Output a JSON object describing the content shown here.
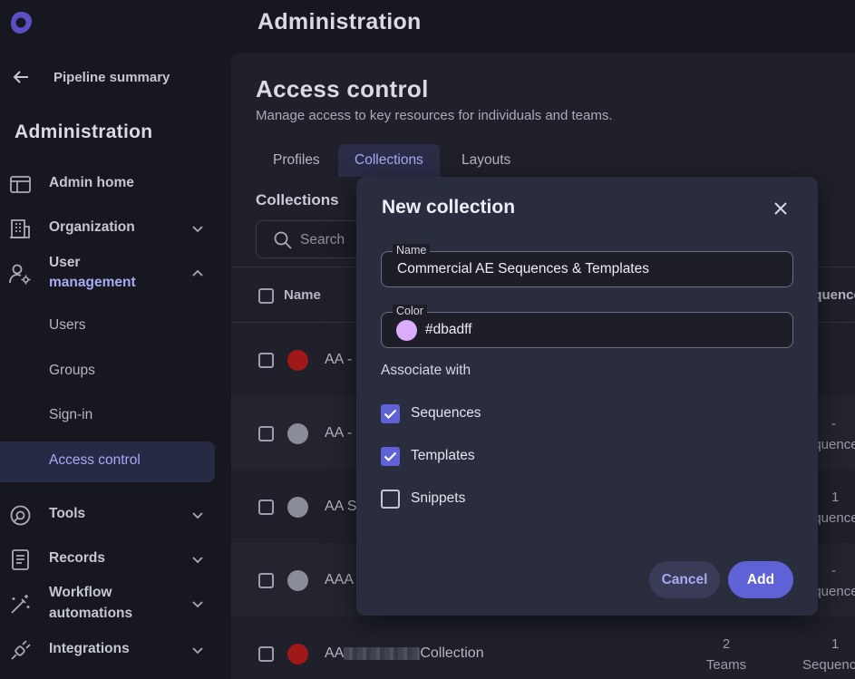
{
  "header": {
    "title": "Administration"
  },
  "sidebar": {
    "back_label": "Pipeline summary",
    "section_title": "Administration",
    "items": [
      {
        "label": "Admin home",
        "icon": "layout-icon"
      },
      {
        "label": "Organization",
        "icon": "building-icon"
      },
      {
        "label_line1": "User",
        "label_line2": "management",
        "icon": "user-gear-icon"
      },
      {
        "label": "Tools",
        "icon": "tools-icon"
      },
      {
        "label": "Records",
        "icon": "records-icon"
      },
      {
        "label_line1": "Workflow",
        "label_line2": "automations",
        "icon": "wand-icon"
      },
      {
        "label": "Integrations",
        "icon": "plug-icon"
      }
    ],
    "sub_items": [
      "Users",
      "Groups",
      "Sign-in",
      "Access control"
    ]
  },
  "main": {
    "title": "Access control",
    "subtitle": "Manage access to key resources for individuals and teams.",
    "tabs": [
      "Profiles",
      "Collections",
      "Layouts"
    ],
    "active_tab": "Collections",
    "collections_title": "Collections",
    "search_placeholder": "Search",
    "table": {
      "col_name": "Name",
      "col_sequences": "equence",
      "rows": [
        {
          "name": "AA - I",
          "color": "#a01818",
          "c1": "",
          "c1b": "",
          "c2": "",
          "c2b": ""
        },
        {
          "name": "AA - I",
          "color": "#8a8c99",
          "c1": "",
          "c1b": "",
          "c2": "-",
          "c2b": "equence"
        },
        {
          "name": "AA Sa",
          "color": "#8a8c99",
          "c1": "",
          "c1b": "",
          "c2": "1",
          "c2b": "equence"
        },
        {
          "name": "AAA -",
          "color": "#8a8c99",
          "c1": "",
          "c1b": "",
          "c2": "-",
          "c2b": "equence"
        },
        {
          "name_prefix": "AA",
          "name_suffix": "Collection",
          "color": "#a01818",
          "c1": "2",
          "c1b": "Teams",
          "c2": "1",
          "c2b": "Sequenc"
        }
      ]
    }
  },
  "modal": {
    "title": "New collection",
    "name_label": "Name",
    "name_value": "Commercial AE Sequences & Templates",
    "color_label": "Color",
    "color_value": "#dbadff",
    "associate_label": "Associate with",
    "options": [
      {
        "label": "Sequences",
        "checked": true
      },
      {
        "label": "Templates",
        "checked": true
      },
      {
        "label": "Snippets",
        "checked": false
      }
    ],
    "cancel_label": "Cancel",
    "add_label": "Add"
  }
}
